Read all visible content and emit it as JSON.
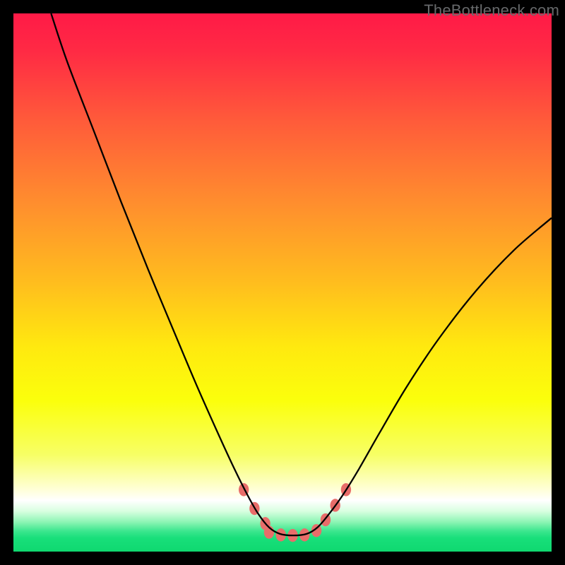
{
  "watermark": "TheBottleneck.com",
  "chart_data": {
    "type": "line",
    "title": "",
    "xlabel": "",
    "ylabel": "",
    "xlim": [
      0,
      100
    ],
    "ylim": [
      0,
      100
    ],
    "gradient_stops": [
      {
        "offset": 0.0,
        "color": "#ff1a47"
      },
      {
        "offset": 0.07,
        "color": "#ff2a44"
      },
      {
        "offset": 0.2,
        "color": "#ff5b3a"
      },
      {
        "offset": 0.35,
        "color": "#ff8d2e"
      },
      {
        "offset": 0.5,
        "color": "#ffbd1e"
      },
      {
        "offset": 0.62,
        "color": "#ffe90f"
      },
      {
        "offset": 0.72,
        "color": "#fbff0c"
      },
      {
        "offset": 0.82,
        "color": "#f7ff65"
      },
      {
        "offset": 0.885,
        "color": "#ffffd8"
      },
      {
        "offset": 0.905,
        "color": "#ffffff"
      },
      {
        "offset": 0.925,
        "color": "#d8ffe0"
      },
      {
        "offset": 0.945,
        "color": "#8cf5b4"
      },
      {
        "offset": 0.962,
        "color": "#3be68e"
      },
      {
        "offset": 0.975,
        "color": "#18df7a"
      },
      {
        "offset": 1.0,
        "color": "#0fd870"
      }
    ],
    "series": [
      {
        "name": "bottleneck-curve",
        "stroke": "#000000",
        "stroke_width": 2.3,
        "points": [
          {
            "x": 7.0,
            "y": 100.0
          },
          {
            "x": 10.0,
            "y": 91.0
          },
          {
            "x": 15.0,
            "y": 78.0
          },
          {
            "x": 20.0,
            "y": 65.0
          },
          {
            "x": 25.0,
            "y": 52.5
          },
          {
            "x": 30.0,
            "y": 40.5
          },
          {
            "x": 34.0,
            "y": 31.0
          },
          {
            "x": 38.0,
            "y": 22.0
          },
          {
            "x": 41.0,
            "y": 15.5
          },
          {
            "x": 43.5,
            "y": 10.5
          },
          {
            "x": 45.5,
            "y": 7.0
          },
          {
            "x": 47.5,
            "y": 4.5
          },
          {
            "x": 49.5,
            "y": 3.3
          },
          {
            "x": 52.0,
            "y": 3.0
          },
          {
            "x": 54.5,
            "y": 3.3
          },
          {
            "x": 56.5,
            "y": 4.5
          },
          {
            "x": 58.5,
            "y": 6.8
          },
          {
            "x": 61.0,
            "y": 10.2
          },
          {
            "x": 64.0,
            "y": 15.0
          },
          {
            "x": 68.0,
            "y": 22.0
          },
          {
            "x": 73.0,
            "y": 30.5
          },
          {
            "x": 79.0,
            "y": 39.5
          },
          {
            "x": 86.0,
            "y": 48.5
          },
          {
            "x": 93.0,
            "y": 56.0
          },
          {
            "x": 100.0,
            "y": 62.0
          }
        ]
      }
    ],
    "markers": {
      "name": "curve-markers",
      "fill": "#e86d6a",
      "rx": 7.2,
      "ry": 9.2,
      "points": [
        {
          "x": 42.8,
          "y": 11.5
        },
        {
          "x": 44.8,
          "y": 8.0
        },
        {
          "x": 46.8,
          "y": 5.2
        },
        {
          "x": 47.5,
          "y": 3.6
        },
        {
          "x": 49.7,
          "y": 3.1
        },
        {
          "x": 51.9,
          "y": 3.0
        },
        {
          "x": 54.1,
          "y": 3.1
        },
        {
          "x": 56.3,
          "y": 3.9
        },
        {
          "x": 58.0,
          "y": 5.9
        },
        {
          "x": 59.8,
          "y": 8.6
        },
        {
          "x": 61.8,
          "y": 11.5
        }
      ]
    }
  }
}
